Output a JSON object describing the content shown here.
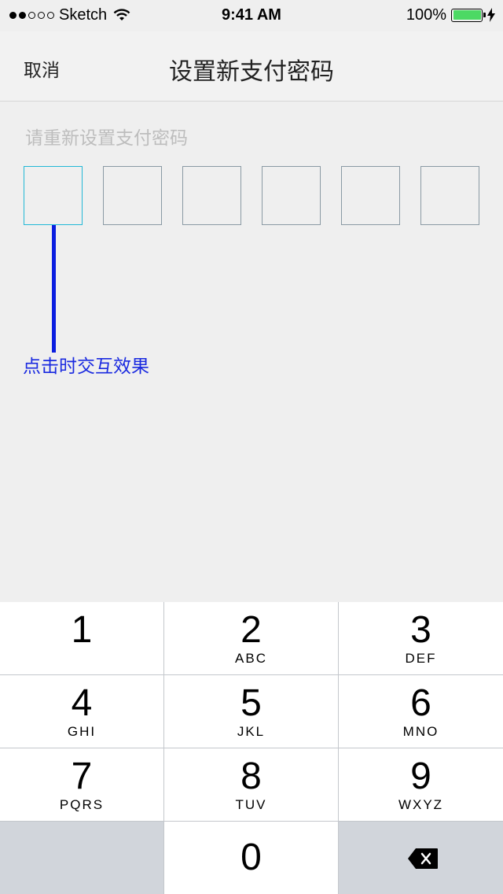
{
  "status_bar": {
    "carrier": "Sketch",
    "time": "9:41 AM",
    "battery": "100%",
    "battery_level": 1.0,
    "signal_bars_filled": 2,
    "signal_bars_total": 5
  },
  "nav": {
    "cancel": "取消",
    "title": "设置新支付密码"
  },
  "content": {
    "prompt": "请重新设置支付密码",
    "pin_length": 6,
    "active_index": 0,
    "annotation": "点击时交互效果"
  },
  "keypad": {
    "keys": [
      {
        "num": "1",
        "letters": ""
      },
      {
        "num": "2",
        "letters": "ABC"
      },
      {
        "num": "3",
        "letters": "DEF"
      },
      {
        "num": "4",
        "letters": "GHI"
      },
      {
        "num": "5",
        "letters": "JKL"
      },
      {
        "num": "6",
        "letters": "MNO"
      },
      {
        "num": "7",
        "letters": "PQRS"
      },
      {
        "num": "8",
        "letters": "TUV"
      },
      {
        "num": "9",
        "letters": "WXYZ"
      },
      {
        "num": "0",
        "letters": ""
      }
    ]
  },
  "colors": {
    "active_box": "#22b8d6",
    "box_border": "#8a9aa4",
    "annotation": "#1a2ae0",
    "battery_fill": "#4cd964"
  }
}
